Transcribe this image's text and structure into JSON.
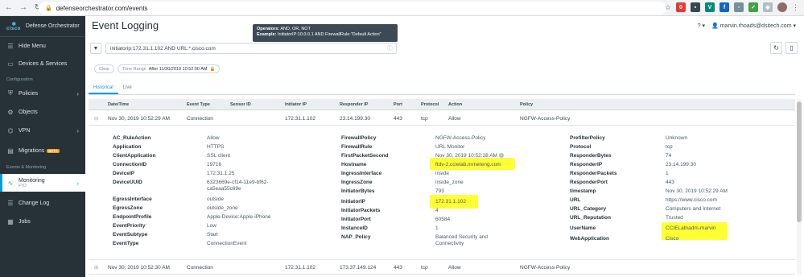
{
  "browser": {
    "url": "defenseorchestrator.com/events"
  },
  "sidebar": {
    "brand_logo": "cisco",
    "brand_name": "Defense Orchestrator",
    "hide_menu": "Hide Menu",
    "devices": "Devices & Services",
    "section_config": "Configuration",
    "policies": "Policies",
    "objects": "Objects",
    "vpn": "VPN",
    "migrations": "Migrations",
    "beta": "BETA",
    "section_events": "Events & Monitoring",
    "monitoring": "Monitoring",
    "monitoring_sub": "FTD",
    "change_log": "Change Log",
    "jobs": "Jobs"
  },
  "header": {
    "title": "Event Logging",
    "help": "?",
    "user": "marvin.rhoads@dsitech.com"
  },
  "tooltip": {
    "operators_label": "Operators:",
    "operators_value": "AND, OR, NOT",
    "example_label": "Example:",
    "example_value": "InitiatorIP:10.0.0.1 AND FirewallRule:\"Default Action\""
  },
  "search": {
    "query": "initiatorip:172.31.1.102 AND URL:*.cisco.com"
  },
  "filters": {
    "clear": "Clear",
    "time_range_label": "Time Range",
    "time_range_value": "After 11/30/2019 10:52:00 AM"
  },
  "tabs": [
    "Historical",
    "Live"
  ],
  "table": {
    "headers": [
      "Date/Time",
      "Event Type",
      "Sensor ID",
      "Initiator IP",
      "Responder IP",
      "Port",
      "Protocol",
      "Action",
      "Policy"
    ],
    "rows": [
      [
        "Nov 30, 2019 10:52:29 AM",
        "Connection",
        "",
        "172.31.1.102",
        "23.14.199.30",
        "443",
        "tcp",
        "Allow",
        "NGFW-Access-Policy"
      ],
      [
        "Nov 30, 2019 10:52:30 AM",
        "Connection",
        "",
        "172.31.1.102",
        "173.37.149.124",
        "443",
        "tcp",
        "Allow",
        "NGFW-Access-Policy"
      ]
    ]
  },
  "details": {
    "col1": [
      [
        "AC_RuleAction",
        "Allow"
      ],
      [
        "Application",
        "HTTPS"
      ],
      [
        "ClientApplication",
        "SSL client"
      ],
      [
        "ConnectionID",
        "19716"
      ],
      [
        "DeviceIP",
        "172.31.1.25"
      ],
      [
        "DeviceUUID",
        "6323669e-cf14-11e9-bf62-\nca5eaa55c69e"
      ],
      [
        "EgressInterface",
        "outside"
      ],
      [
        "EgressZone",
        "outside_zone"
      ],
      [
        "EndpointProfile",
        "Apple-Device:Apple-iPhone"
      ],
      [
        "EventPriority",
        "Low"
      ],
      [
        "EventSubtype",
        "Start"
      ],
      [
        "EventType",
        "ConnectionEvent"
      ]
    ],
    "col2": [
      [
        "FirewallPolicy",
        "NGFW-Access-Policy"
      ],
      [
        "FirewallRule",
        "URL Monitor"
      ],
      [
        "FirstPacketSecond",
        "Nov 30, 2019 10:52:28 AM"
      ],
      [
        "Hostname",
        "ftdv-2.ccielab.mrneteng.com"
      ],
      [
        "IngressInterface",
        "inside"
      ],
      [
        "IngressZone",
        "inside_zone"
      ],
      [
        "InitiatorBytes",
        "793"
      ],
      [
        "InitiatorIP",
        "172.31.1.102"
      ],
      [
        "InitiatorPackets",
        "4"
      ],
      [
        "InitiatorPort",
        "60584"
      ],
      [
        "InstanceID",
        "1"
      ],
      [
        "NAP_Policy",
        "Balanced Security and\nConnectivity"
      ]
    ],
    "col3": [
      [
        "PrefilterPolicy",
        "Unknown"
      ],
      [
        "Protocol",
        "tcp"
      ],
      [
        "ResponderBytes",
        "74"
      ],
      [
        "ResponderIP",
        "23.14.199.30"
      ],
      [
        "ResponderPackets",
        "1"
      ],
      [
        "ResponderPort",
        "443"
      ],
      [
        "timestamp",
        "Nov 30, 2019 10:52:29 AM"
      ],
      [
        "URL",
        "https://www.cisco.com"
      ],
      [
        "URL_Category",
        "Computers and Internet"
      ],
      [
        "URL_Reputation",
        "Trusted"
      ],
      [
        "UserName",
        "CCIELab\\adm-marvin"
      ],
      [
        "WebApplication",
        "Cisco"
      ]
    ]
  },
  "colors": {
    "accent": "#049fd9",
    "sidebar_bg": "#263238",
    "highlight": "#ffff33"
  }
}
